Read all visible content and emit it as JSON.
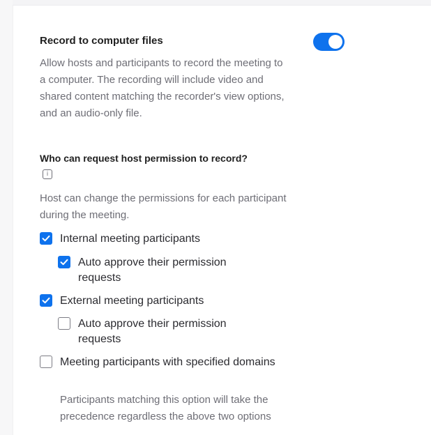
{
  "record_setting": {
    "title": "Record to computer files",
    "enabled": true,
    "description": "Allow hosts and participants to record the meeting to a computer. The recording will include video and shared content matching the recorder's view options, and an audio-only file."
  },
  "permission_section": {
    "title": "Who can request host permission to record?",
    "info_icon": "info-icon",
    "note": "Host can change the permissions for each participant during the meeting.",
    "options": [
      {
        "label": "Internal meeting participants",
        "checked": true
      },
      {
        "label": "Auto approve their permission requests",
        "checked": true
      },
      {
        "label": "External meeting participants",
        "checked": true
      },
      {
        "label": "Auto approve their permission requests",
        "checked": false
      },
      {
        "label": "Meeting participants with specified domains",
        "checked": false
      }
    ],
    "domains_note": "Participants matching this option will take the precedence regardless the above two options"
  },
  "colors": {
    "accent": "#0e72ed",
    "muted_text": "#6e6e76"
  }
}
